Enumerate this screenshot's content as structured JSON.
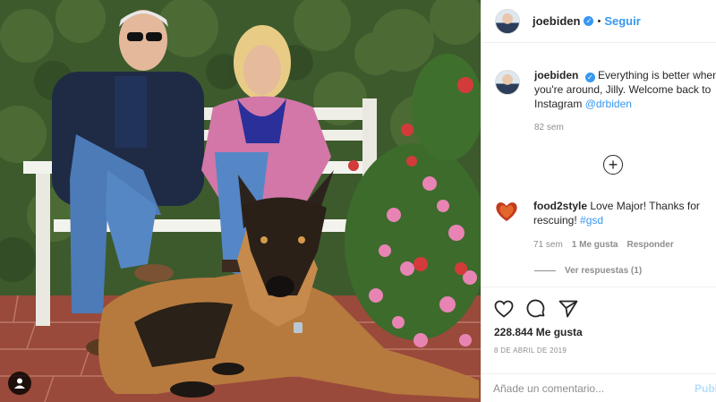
{
  "post": {
    "username": "joebiden",
    "dot": "•",
    "follow_label": "Seguir",
    "caption_user": "joebiden",
    "caption_text": "Everything is better when you're around, Jilly. Welcome back to Instagram",
    "caption_mention": "@drbiden",
    "caption_time": "82 sem"
  },
  "comments": [
    {
      "user": "food2style",
      "text": "Love Major! Thanks for rescuing!",
      "hashtag": "#gsd",
      "time": "71 sem",
      "likes": "1 Me gusta",
      "reply_label": "Responder"
    }
  ],
  "replies_label": "Ver respuestas (1)",
  "likes_label": "228.844 Me gusta",
  "post_date": "8 DE ABRIL DE 2019",
  "comment_input": {
    "placeholder": "Añade un comentario...",
    "value": ""
  },
  "publish_label": "Publicar",
  "icons": [
    "plus-circle-icon",
    "heart-icon",
    "comment-icon",
    "share-icon",
    "user-tag-icon",
    "verified-icon"
  ],
  "colors": {
    "link": "#3897f0",
    "muted": "#8e8e8e",
    "publish_disabled": "#b2dffc",
    "text": "#262626"
  }
}
